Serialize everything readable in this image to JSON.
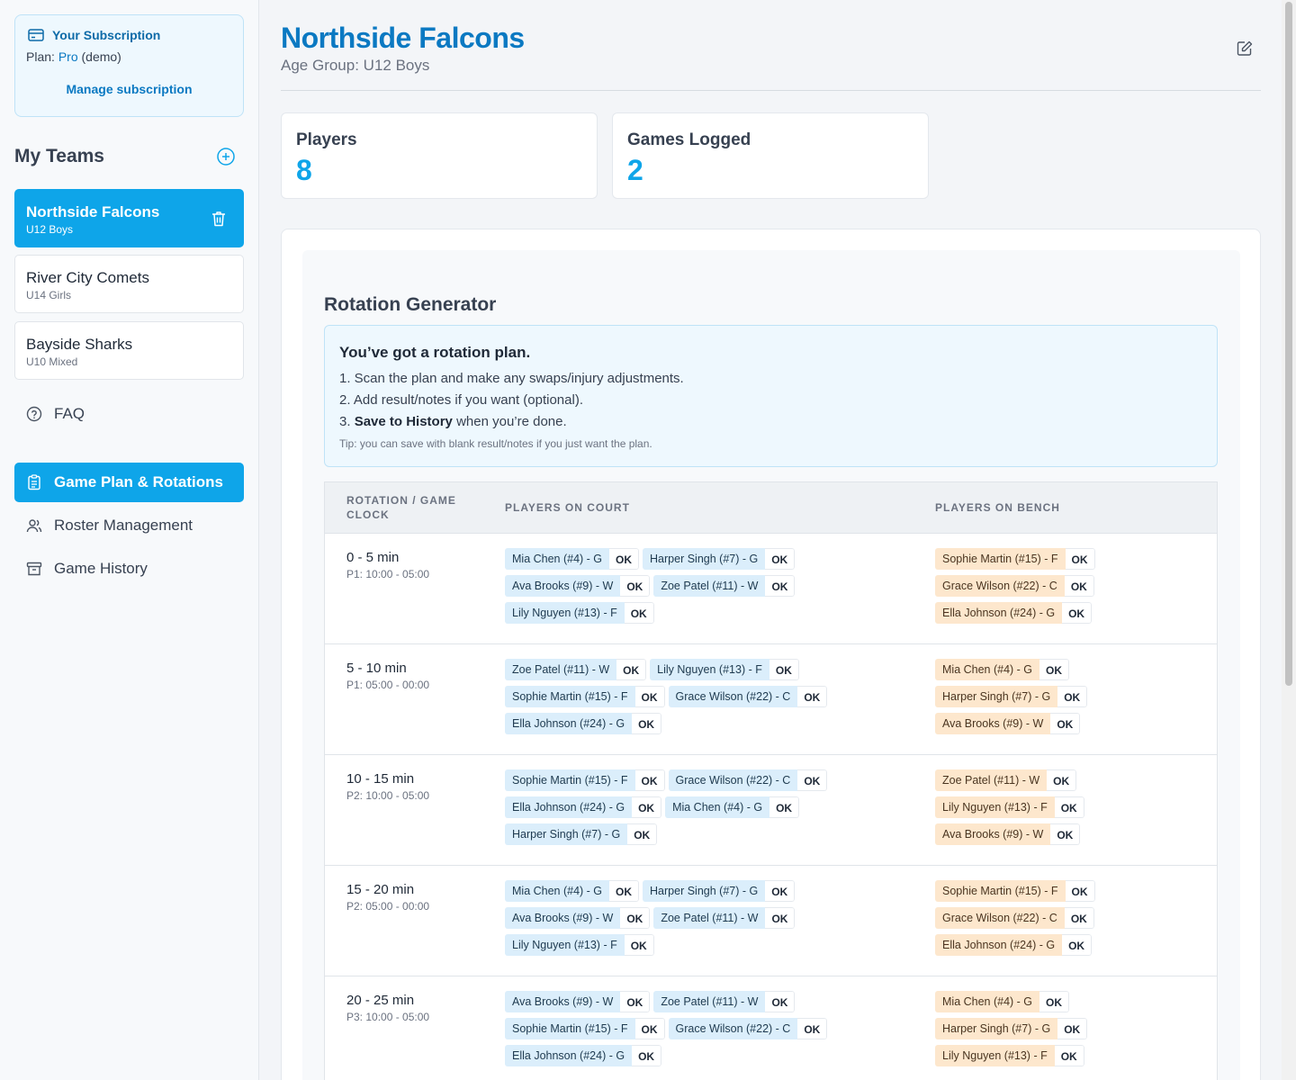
{
  "subscription": {
    "title": "Your Subscription",
    "plan_prefix": "Plan: ",
    "plan_name": "Pro",
    "plan_suffix": " (demo)",
    "manage_label": "Manage subscription",
    "icon": "credit-card-icon"
  },
  "teams_section": {
    "title": "My Teams",
    "add_icon": "plus-circle-icon"
  },
  "teams": [
    {
      "name": "Northside Falcons",
      "group": "U12 Boys",
      "active": true
    },
    {
      "name": "River City Comets",
      "group": "U14 Girls",
      "active": false
    },
    {
      "name": "Bayside Sharks",
      "group": "U10 Mixed",
      "active": false
    }
  ],
  "faq": {
    "label": "FAQ",
    "icon": "help-circle-icon"
  },
  "nav": [
    {
      "label": "Game Plan & Rotations",
      "icon": "clipboard-icon",
      "active": true
    },
    {
      "label": "Roster Management",
      "icon": "users-icon",
      "active": false
    },
    {
      "label": "Game History",
      "icon": "archive-icon",
      "active": false
    }
  ],
  "header": {
    "team_name": "Northside Falcons",
    "age_group": "Age Group: U12 Boys",
    "edit_icon": "edit-icon"
  },
  "stats": {
    "players_label": "Players",
    "players_value": "8",
    "games_label": "Games Logged",
    "games_value": "2"
  },
  "rotation": {
    "title": "Rotation Generator",
    "info_title": "You’ve got a rotation plan.",
    "step1": "1. Scan the plan and make any swaps/injury adjustments.",
    "step2": "2. Add result/notes if you want (optional).",
    "step3_prefix": "3. ",
    "step3_bold": "Save to History",
    "step3_suffix": " when you’re done.",
    "tip": "Tip: you can save with blank result/notes if you just want the plan.",
    "columns": {
      "time": "Rotation / Game Clock",
      "court": "Players on Court",
      "bench": "Players on Bench"
    },
    "ok_label": "OK",
    "rows": [
      {
        "time": "0 - 5 min",
        "clock": "P1: 10:00 - 05:00",
        "court": [
          "Mia Chen (#4) - G",
          "Harper Singh (#7) - G",
          "Ava Brooks (#9) - W",
          "Zoe Patel (#11) - W",
          "Lily Nguyen (#13) - F"
        ],
        "bench": [
          "Sophie Martin (#15) - F",
          "Grace Wilson (#22) - C",
          "Ella Johnson (#24) - G"
        ]
      },
      {
        "time": "5 - 10 min",
        "clock": "P1: 05:00 - 00:00",
        "court": [
          "Zoe Patel (#11) - W",
          "Lily Nguyen (#13) - F",
          "Sophie Martin (#15) - F",
          "Grace Wilson (#22) - C",
          "Ella Johnson (#24) - G"
        ],
        "bench": [
          "Mia Chen (#4) - G",
          "Harper Singh (#7) - G",
          "Ava Brooks (#9) - W"
        ]
      },
      {
        "time": "10 - 15 min",
        "clock": "P2: 10:00 - 05:00",
        "court": [
          "Sophie Martin (#15) - F",
          "Grace Wilson (#22) - C",
          "Ella Johnson (#24) - G",
          "Mia Chen (#4) - G",
          "Harper Singh (#7) - G"
        ],
        "bench": [
          "Zoe Patel (#11) - W",
          "Lily Nguyen (#13) - F",
          "Ava Brooks (#9) - W"
        ]
      },
      {
        "time": "15 - 20 min",
        "clock": "P2: 05:00 - 00:00",
        "court": [
          "Mia Chen (#4) - G",
          "Harper Singh (#7) - G",
          "Ava Brooks (#9) - W",
          "Zoe Patel (#11) - W",
          "Lily Nguyen (#13) - F"
        ],
        "bench": [
          "Sophie Martin (#15) - F",
          "Grace Wilson (#22) - C",
          "Ella Johnson (#24) - G"
        ]
      },
      {
        "time": "20 - 25 min",
        "clock": "P3: 10:00 - 05:00",
        "court": [
          "Ava Brooks (#9) - W",
          "Zoe Patel (#11) - W",
          "Sophie Martin (#15) - F",
          "Grace Wilson (#22) - C",
          "Ella Johnson (#24) - G"
        ],
        "bench": [
          "Mia Chen (#4) - G",
          "Harper Singh (#7) - G",
          "Lily Nguyen (#13) - F"
        ]
      }
    ]
  },
  "colors": {
    "accent": "#0ea5e9",
    "brand_text": "#0b79c2",
    "court_chip": "#dbeefb",
    "bench_chip": "#fde7cd"
  }
}
